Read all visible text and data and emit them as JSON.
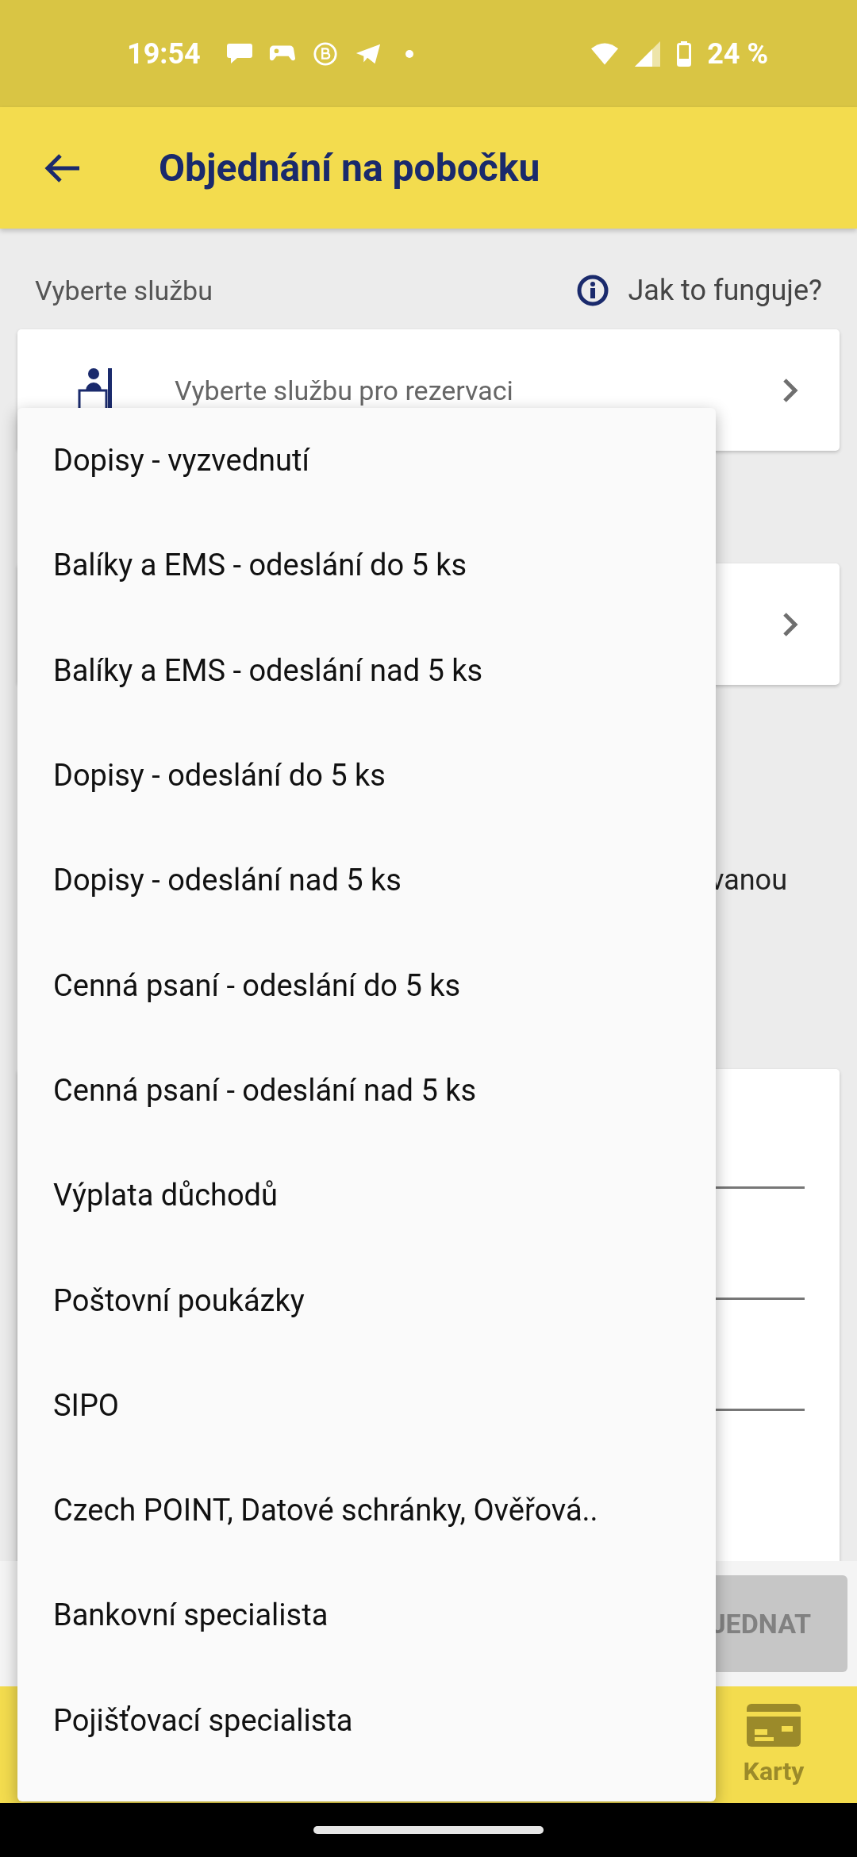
{
  "status_bar": {
    "time": "19:54",
    "battery": "24 %"
  },
  "header": {
    "title": "Objednání na pobočku"
  },
  "section": {
    "label": "Vyberte službu",
    "help_link": "Jak to funguje?"
  },
  "service_field": {
    "placeholder": "Vyberte službu pro rezervaci"
  },
  "partial_text": "vanou",
  "submit_button": {
    "label": "JEDNAT",
    "disabled": true
  },
  "bottom_nav": [
    {
      "label": "Karty"
    }
  ],
  "menu": {
    "items": [
      {
        "label": "Dopisy - vyzvednutí"
      },
      {
        "label": "Balíky a EMS - odeslání do 5 ks"
      },
      {
        "label": "Balíky a EMS - odeslání nad 5 ks"
      },
      {
        "label": "Dopisy - odeslání do 5 ks"
      },
      {
        "label": "Dopisy - odeslání nad 5 ks"
      },
      {
        "label": "Cenná psaní - odeslání do 5 ks"
      },
      {
        "label": "Cenná psaní - odeslání nad 5 ks"
      },
      {
        "label": "Výplata důchodů"
      },
      {
        "label": "Poštovní poukázky"
      },
      {
        "label": "SIPO"
      },
      {
        "label": "Czech POINT, Datové schránky, Ověřová.."
      },
      {
        "label": "Bankovní specialista"
      },
      {
        "label": "Pojišťovací specialista"
      }
    ]
  }
}
